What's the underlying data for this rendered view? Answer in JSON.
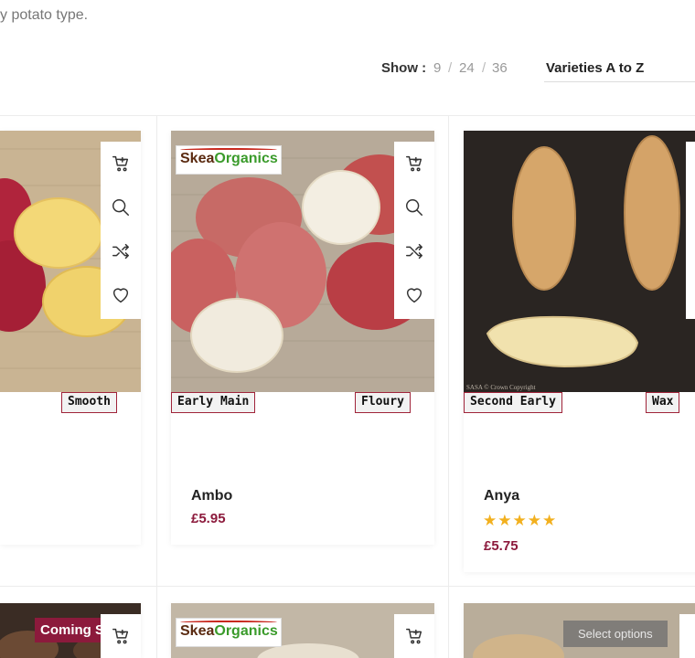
{
  "intro": {
    "text": "y potato type."
  },
  "toolbar": {
    "show_label": "Show :",
    "show_options": [
      "9",
      "24",
      "36"
    ],
    "separator": "/",
    "sort_value": "Varieties A to Z"
  },
  "products": [
    {
      "name": "",
      "price": "",
      "tags": [
        "Smooth"
      ]
    },
    {
      "name": "Ambo",
      "price": "£5.95",
      "brand": [
        "Skea",
        "Organics"
      ],
      "tags": [
        "Early Main",
        "Floury"
      ]
    },
    {
      "name": "Anya",
      "price": "£5.75",
      "stars": "★★★★★",
      "rating": 5,
      "tags": [
        "Second Early",
        "Wax"
      ],
      "copyright": "SASA © Crown Copyright"
    }
  ],
  "row2": {
    "badge": "Coming Soon",
    "brand": [
      "Skea",
      "Organics"
    ],
    "select_options": "Select options"
  },
  "colors": {
    "accent": "#8c1a3c",
    "star": "#f2b01e",
    "tag_border": "#a0243a"
  },
  "icons": [
    "cart-icon",
    "search-icon",
    "compare-icon",
    "heart-icon"
  ]
}
